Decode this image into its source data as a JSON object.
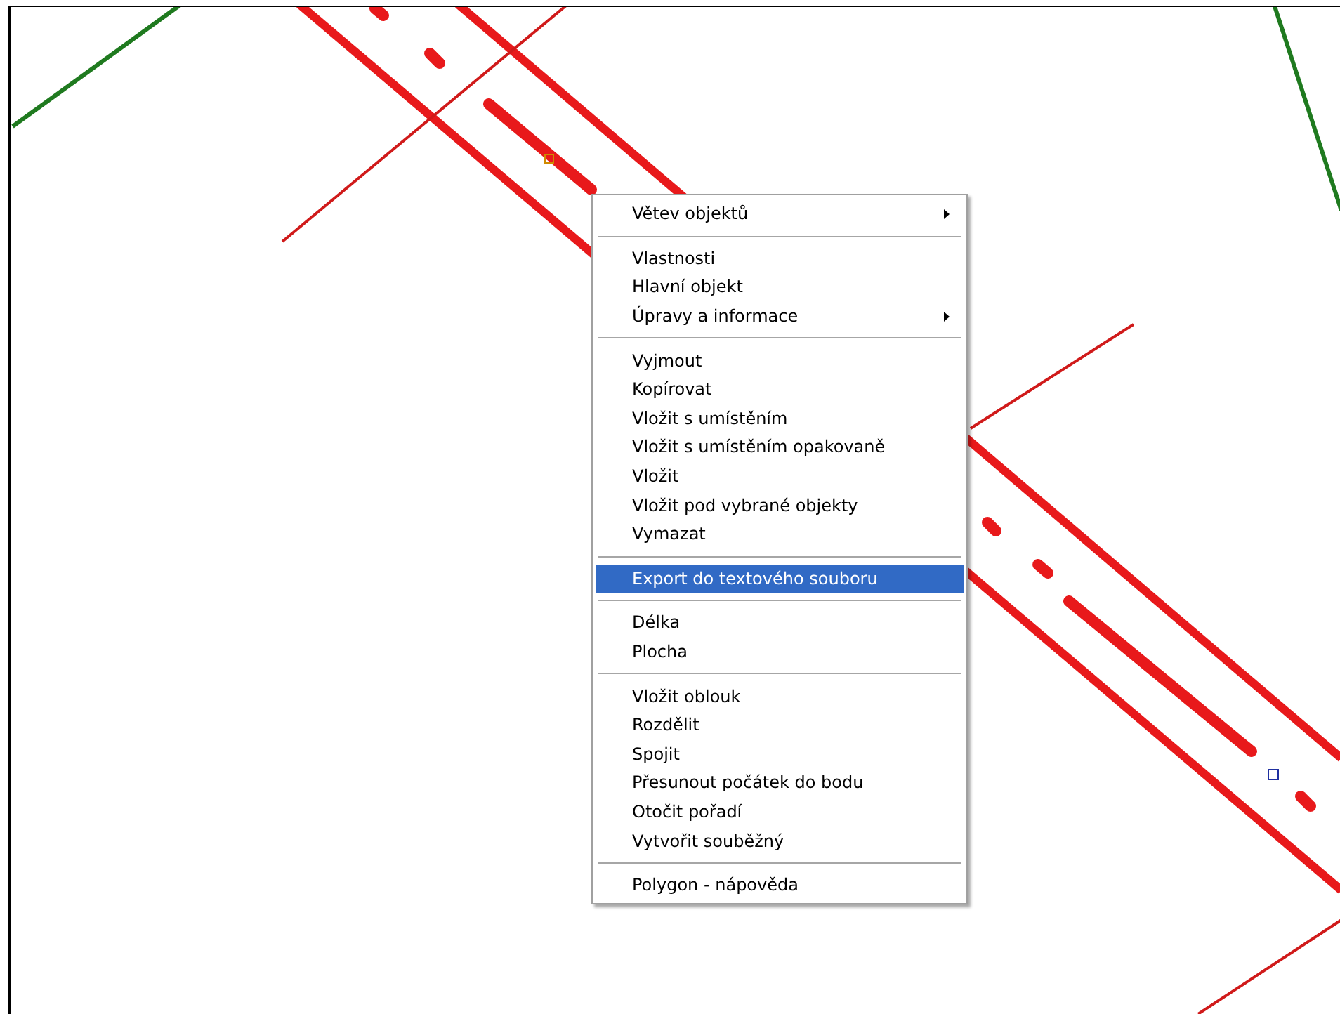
{
  "context_menu": {
    "sections": [
      {
        "items": [
          {
            "label": "Větev objektů",
            "has_submenu": true,
            "selected": false
          }
        ]
      },
      {
        "items": [
          {
            "label": "Vlastnosti",
            "has_submenu": false,
            "selected": false
          },
          {
            "label": "Hlavní objekt",
            "has_submenu": false,
            "selected": false
          },
          {
            "label": "Úpravy a informace",
            "has_submenu": true,
            "selected": false
          }
        ]
      },
      {
        "items": [
          {
            "label": "Vyjmout",
            "has_submenu": false,
            "selected": false
          },
          {
            "label": "Kopírovat",
            "has_submenu": false,
            "selected": false
          },
          {
            "label": "Vložit s umístěním",
            "has_submenu": false,
            "selected": false
          },
          {
            "label": "Vložit s umístěním opakovaně",
            "has_submenu": false,
            "selected": false
          },
          {
            "label": "Vložit",
            "has_submenu": false,
            "selected": false
          },
          {
            "label": "Vložit pod vybrané objekty",
            "has_submenu": false,
            "selected": false
          },
          {
            "label": "Vymazat",
            "has_submenu": false,
            "selected": false
          }
        ]
      },
      {
        "items": [
          {
            "label": "Export do textového souboru",
            "has_submenu": false,
            "selected": true
          }
        ]
      },
      {
        "items": [
          {
            "label": "Délka",
            "has_submenu": false,
            "selected": false
          },
          {
            "label": "Plocha",
            "has_submenu": false,
            "selected": false
          }
        ]
      },
      {
        "items": [
          {
            "label": "Vložit oblouk",
            "has_submenu": false,
            "selected": false
          },
          {
            "label": "Rozdělit",
            "has_submenu": false,
            "selected": false
          },
          {
            "label": "Spojit",
            "has_submenu": false,
            "selected": false
          },
          {
            "label": "Přesunout počátek do bodu",
            "has_submenu": false,
            "selected": false
          },
          {
            "label": "Otočit pořadí",
            "has_submenu": false,
            "selected": false
          },
          {
            "label": "Vytvořit souběžný",
            "has_submenu": false,
            "selected": false
          }
        ]
      },
      {
        "items": [
          {
            "label": "Polygon - nápověda",
            "has_submenu": false,
            "selected": false
          }
        ]
      }
    ]
  }
}
